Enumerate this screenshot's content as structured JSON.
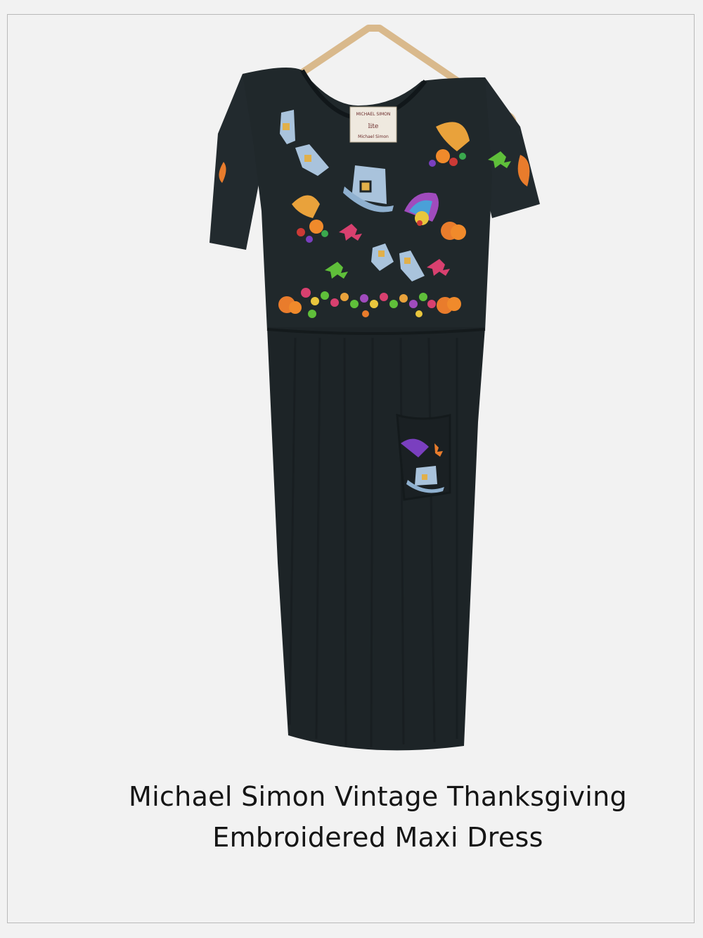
{
  "colors": {
    "background": "#f2f2f2",
    "frame": "#b9b9b9",
    "dress": "#1f2629",
    "hanger": "#d9b98c",
    "caption_text": "#151515"
  },
  "caption": {
    "line1": "Michael Simon Vintage Thanksgiving",
    "line2": "Embroidered Maxi Dress"
  },
  "tag": {
    "text_top": "MICHAEL SIMON",
    "text_mid": "lite",
    "text_bottom": "Michael Simon"
  },
  "icons": [
    "hanger-icon",
    "pilgrim-hat-icon",
    "pilgrim-shoe-icon",
    "cornucopia-icon",
    "turkey-icon",
    "pumpkin-icon",
    "maple-leaf-icon"
  ]
}
